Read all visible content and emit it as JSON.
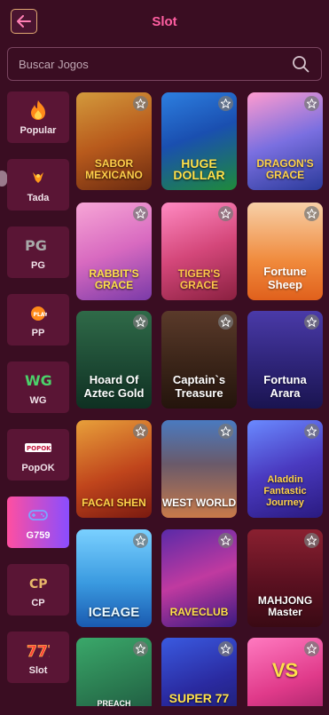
{
  "header": {
    "title": "Slot"
  },
  "search": {
    "placeholder": "Buscar Jogos"
  },
  "sidebar": {
    "items": [
      {
        "label": "Popular",
        "icon": "fire-icon"
      },
      {
        "label": "Tada",
        "icon": "tada-icon"
      },
      {
        "label": "PG",
        "icon": "pg-icon"
      },
      {
        "label": "PP",
        "icon": "pp-icon"
      },
      {
        "label": "WG",
        "icon": "wg-icon"
      },
      {
        "label": "PopOK",
        "icon": "popok-icon"
      },
      {
        "label": "G759",
        "icon": "gamepad-icon",
        "active": true
      },
      {
        "label": "CP",
        "icon": "cp-icon"
      },
      {
        "label": "Slot",
        "icon": "slot-777-icon"
      }
    ]
  },
  "games": [
    {
      "label": "SABOR MEXICANO"
    },
    {
      "label": "HUGE DOLLAR"
    },
    {
      "label": "DRAGON'S GRACE"
    },
    {
      "label": "RABBIT'S GRACE"
    },
    {
      "label": "TIGER'S GRACE"
    },
    {
      "label": "Fortune Sheep"
    },
    {
      "label": "Hoard Of Aztec Gold"
    },
    {
      "label": "Captain`s Treasure"
    },
    {
      "label": "Fortuna Arara"
    },
    {
      "label": "FACAI SHEN"
    },
    {
      "label": "WEST WORLD"
    },
    {
      "label": "Aladdin Fantastic Journey"
    },
    {
      "label": "ICEAGE"
    },
    {
      "label": "RAVECLUB"
    },
    {
      "label": "MAHJONG Master"
    },
    {
      "label": "PREACH"
    },
    {
      "label": "SUPER 77"
    },
    {
      "label": "VS"
    }
  ],
  "colors": {
    "background": "#3a0d22",
    "accent": "#ff5fa2",
    "sidebar_item": "#5a1535"
  }
}
